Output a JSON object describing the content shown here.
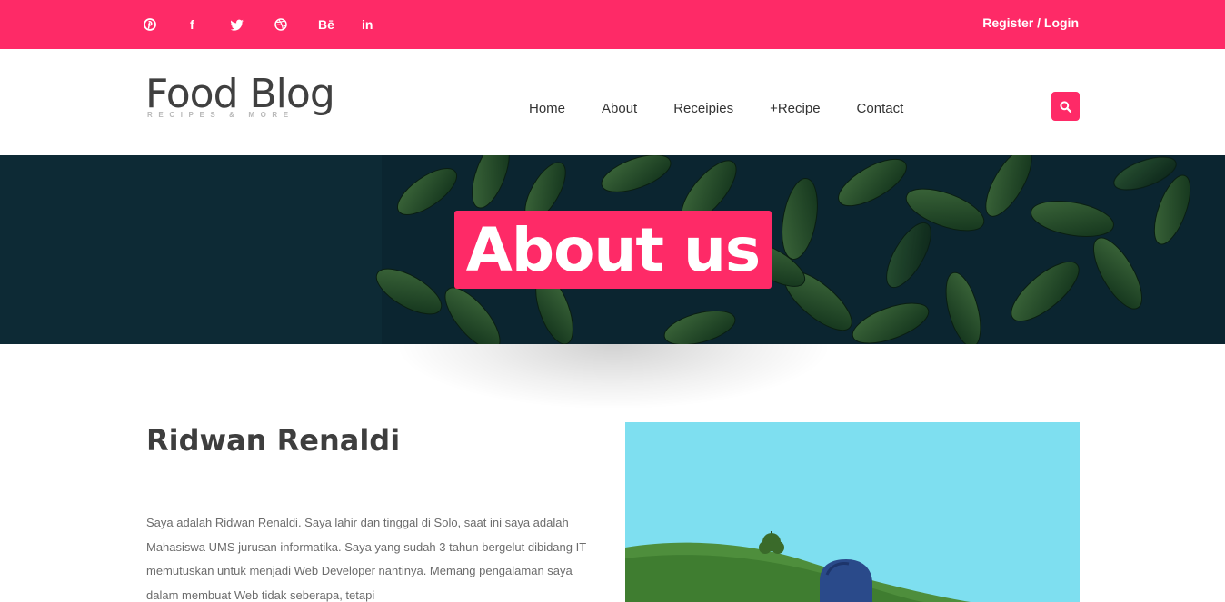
{
  "topbar": {
    "social_icons": [
      "pinterest-icon",
      "facebook-icon",
      "twitter-icon",
      "dribbble-icon",
      "behance-icon",
      "linkedin-icon"
    ],
    "behance_text": "Bē",
    "linkedin_text": "in",
    "facebook_text": "f",
    "auth_label": "Register / Login"
  },
  "header": {
    "logo_title": "Food Blog",
    "logo_subtitle": "RECIPES & MORE",
    "nav": [
      "Home",
      "About",
      "Receipies",
      "+Recipe",
      "Contact"
    ]
  },
  "hero": {
    "title": "About us"
  },
  "content": {
    "author_name": "Ridwan Renaldi",
    "bio": "Saya adalah Ridwan Renaldi. Saya lahir dan tinggal di Solo, saat ini saya adalah Mahasiswa UMS jurusan informatika. Saya yang sudah 3 tahun bergelut dibidang IT memutuskan untuk menjadi Web Developer nantinya. Memang pengalaman saya dalam membuat Web tidak seberapa, tetapi"
  },
  "colors": {
    "accent": "#fe2a67",
    "hero_bg": "#0c2733",
    "heading": "#3e3e3e",
    "body_text": "#6c6c6c"
  }
}
